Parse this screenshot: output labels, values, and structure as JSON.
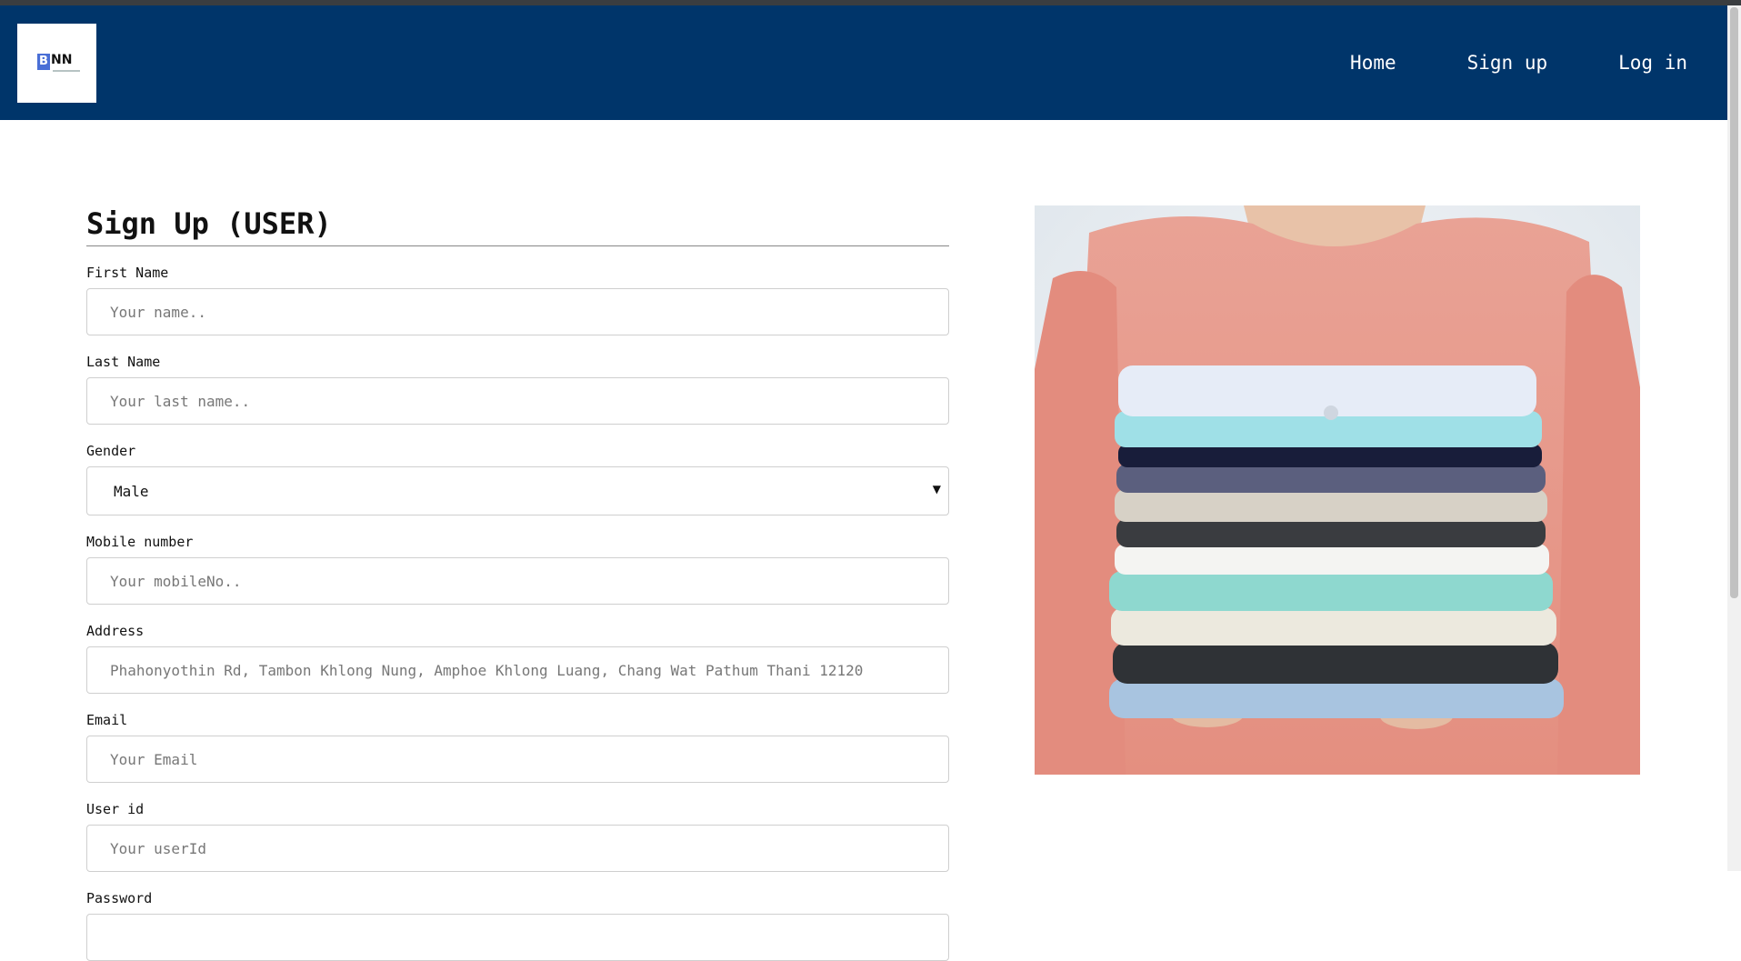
{
  "brand": {
    "logo_letter": "B",
    "logo_text": "NN"
  },
  "nav": {
    "home": "Home",
    "signup": "Sign up",
    "login": "Log in"
  },
  "form": {
    "title": "Sign Up (USER)",
    "fields": {
      "first_name": {
        "label": "First Name",
        "placeholder": "Your name.."
      },
      "last_name": {
        "label": "Last Name",
        "placeholder": "Your last name.."
      },
      "gender": {
        "label": "Gender",
        "value": "Male"
      },
      "mobile": {
        "label": "Mobile number",
        "placeholder": "Your mobileNo.."
      },
      "address": {
        "label": "Address",
        "placeholder": "Phahonyothin Rd, Tambon Khlong Nung, Amphoe Khlong Luang, Chang Wat Pathum Thani 12120"
      },
      "email": {
        "label": "Email",
        "placeholder": "Your Email"
      },
      "user_id": {
        "label": "User id",
        "placeholder": "Your userId"
      },
      "password": {
        "label": "Password"
      }
    }
  },
  "colors": {
    "navbar": "#00356a",
    "logo_accent": "#4a6fd6"
  }
}
